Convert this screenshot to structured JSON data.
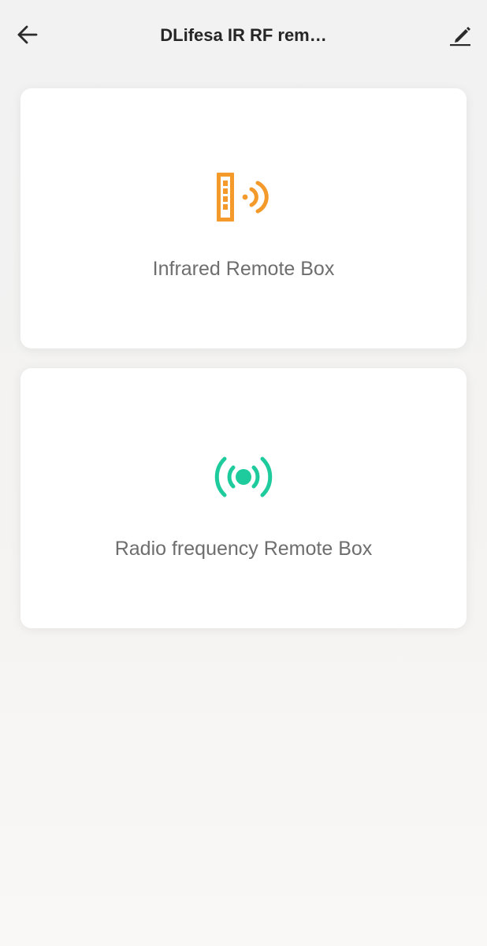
{
  "header": {
    "title": "DLifesa IR RF rem…",
    "back_icon": "arrow-left-icon",
    "edit_icon": "pencil-icon"
  },
  "cards": [
    {
      "label": "Infrared Remote Box",
      "icon": "infrared-remote-icon",
      "color": "#f39a2b"
    },
    {
      "label": "Radio frequency Remote Box",
      "icon": "radio-frequency-icon",
      "color": "#1ecb9c"
    }
  ]
}
